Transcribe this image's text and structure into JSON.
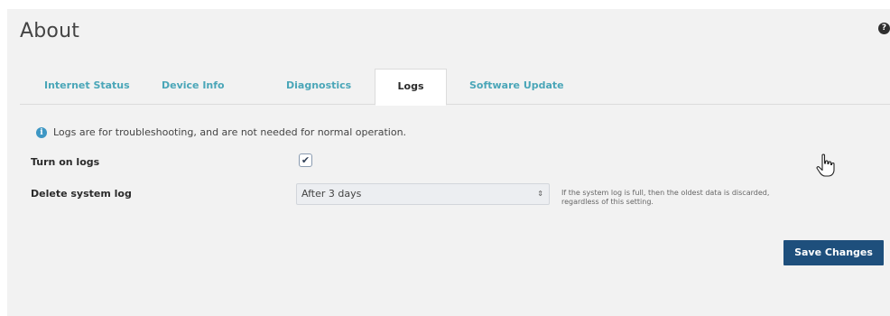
{
  "page": {
    "title": "About",
    "help_icon": "?"
  },
  "tabs": [
    {
      "label": "Internet Status",
      "active": false
    },
    {
      "label": "Device Info",
      "active": false
    },
    {
      "label": "Diagnostics",
      "active": false
    },
    {
      "label": "Logs",
      "active": true
    },
    {
      "label": "Software Update",
      "active": false
    }
  ],
  "logs": {
    "info_icon": "i",
    "info_text": "Logs are for troubleshooting, and are not needed for normal operation.",
    "turn_on_logs": {
      "label": "Turn on logs",
      "checked": true,
      "check_glyph": "✔"
    },
    "delete_system_log": {
      "label": "Delete system log",
      "selected": "After 3 days",
      "arrows": "⇕",
      "hint": "If the system log is full, then the oldest data is discarded, regardless of this setting."
    },
    "save_label": "Save Changes"
  },
  "colors": {
    "accent_tab": "#4aa6b8",
    "button": "#1e4f7c",
    "panel_bg": "#f2f2f2",
    "info_icon": "#3e97c4"
  }
}
